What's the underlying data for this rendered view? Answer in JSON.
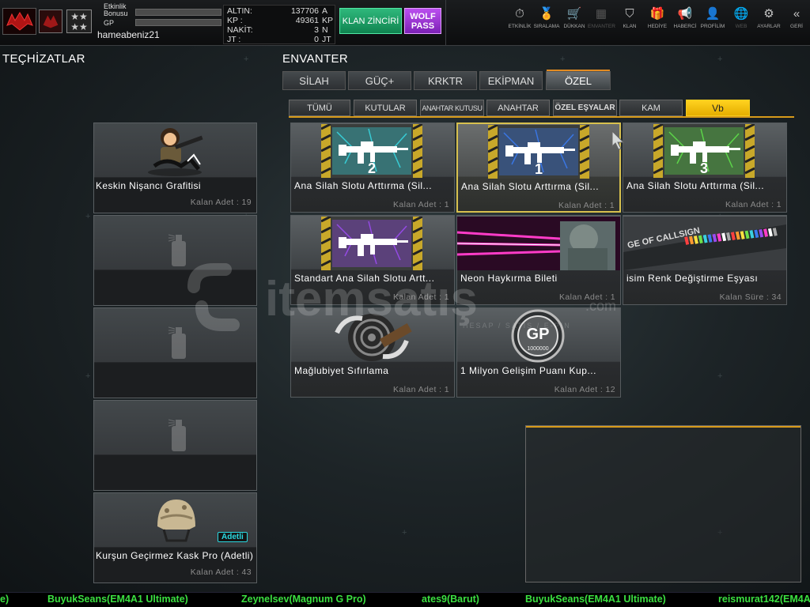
{
  "player": {
    "bonus_label": "Etkinlik\nBonusu",
    "gp_label": "GP",
    "username": "hameabeniz21",
    "rank_stars": "★★\n★★"
  },
  "currencies": [
    {
      "label": "ALTIN:",
      "value": "137706",
      "unit": "A"
    },
    {
      "label": "KP :",
      "value": "49361",
      "unit": "KP"
    },
    {
      "label": "NAKİT:",
      "value": "3",
      "unit": "N"
    },
    {
      "label": "JT :",
      "value": "0",
      "unit": "JT"
    }
  ],
  "buttons": {
    "klan": "KLAN ZİNCİRİ",
    "wolf": "WOLF\nPASS"
  },
  "nav": [
    {
      "label": "ETKİNLİK",
      "icon": "⏱",
      "name": "event",
      "dim": false
    },
    {
      "label": "SIRALAMA",
      "icon": "🏅",
      "name": "ranking",
      "dim": false
    },
    {
      "label": "DÜKKAN",
      "icon": "🛒",
      "name": "shop",
      "dim": false
    },
    {
      "label": "ENVANTER",
      "icon": "▦",
      "name": "inventory",
      "dim": true
    },
    {
      "label": "KLAN",
      "icon": "⛉",
      "name": "clan",
      "dim": false
    },
    {
      "label": "HEDİYE",
      "icon": "🎁",
      "name": "gift",
      "dim": false
    },
    {
      "label": "HABERCİ",
      "icon": "📢",
      "name": "messenger",
      "dim": false
    },
    {
      "label": "PROFİLİM",
      "icon": "👤",
      "name": "profile",
      "dim": false
    },
    {
      "label": "WEB",
      "icon": "🌐",
      "name": "web",
      "dim": true
    },
    {
      "label": "AYARLAR",
      "icon": "⚙",
      "name": "settings",
      "dim": false
    },
    {
      "label": "GERİ",
      "icon": "«",
      "name": "back",
      "dim": false
    }
  ],
  "left": {
    "title": "TEÇHİZATLAR",
    "slots": [
      {
        "name": "Keskin Nişancı Grafitisi",
        "count": "Kalan Adet : 19",
        "empty": false,
        "type": "graffiti"
      },
      {
        "name": "",
        "count": "",
        "empty": true,
        "type": "spray"
      },
      {
        "name": "",
        "count": "",
        "empty": true,
        "type": "spray"
      },
      {
        "name": "",
        "count": "",
        "empty": true,
        "type": "spray"
      },
      {
        "name": "Kurşun Geçirmez Kask Pro (Adetli)",
        "count": "Kalan Adet : 43",
        "empty": false,
        "type": "helmet",
        "badge": "Adetli"
      }
    ]
  },
  "inventory": {
    "title": "ENVANTER",
    "tabs": [
      "SİLAH",
      "GÜÇ+",
      "KRKTR",
      "EKİPMAN",
      "ÖZEL"
    ],
    "active_tab": 4,
    "subtabs": [
      "TÜMÜ",
      "KUTULAR",
      "ANAHTAR KUTUSU",
      "ANAHTAR",
      "ÖZEL EŞYALAR",
      "KAM",
      "Vb"
    ],
    "active_subtab": 6,
    "items": [
      {
        "name": "Ana Silah Slotu Arttırma (Sil...",
        "count": "Kalan Adet : 1",
        "art": "gun",
        "color": "#37d6e0",
        "num": "2",
        "selected": false
      },
      {
        "name": "Ana Silah Slotu Arttırma (Sil...",
        "count": "Kalan Adet : 1",
        "art": "gun",
        "color": "#3a7bf0",
        "num": "1",
        "selected": true
      },
      {
        "name": "Ana Silah Slotu Arttırma (Sil...",
        "count": "Kalan Adet : 1",
        "art": "gun",
        "color": "#5fe04a",
        "num": "3",
        "selected": false
      },
      {
        "name": "Standart Ana Silah Slotu Artt...",
        "count": "Kalan Adet : 1",
        "art": "gun",
        "color": "#9b4bf0",
        "num": "",
        "selected": false
      },
      {
        "name": "Neon Haykırma Bileti",
        "count": "Kalan Adet : 1",
        "art": "neon",
        "color": "#ff3cc8",
        "num": "",
        "selected": false
      },
      {
        "name": "isim Renk Değiştirme Eşyası",
        "count": "Kalan Süre : 34",
        "art": "callsign",
        "color": "#aaaaaa",
        "num": "",
        "caption": "GE OF CALLSIGN",
        "selected": false
      },
      {
        "name": "Mağlubiyet  Sıfırlama",
        "count": "Kalan Adet : 1",
        "art": "target",
        "color": "#888888",
        "num": "",
        "selected": false
      },
      {
        "name": "1 Milyon Gelişim Puanı Kup...",
        "count": "Kalan Adet : 12",
        "art": "gp",
        "color": "#999999",
        "num": "",
        "caption": "GP",
        "sub": "1000000",
        "selected": false
      }
    ]
  },
  "watermark": {
    "text": "itemsatış",
    "domain": ".com",
    "tagline": "HESAP / SATIŞ / E-PIN"
  },
  "ticker": [
    "e)",
    "BuyukSeans(EM4A1 Ultimate)",
    "Zeynelsev(Magnum G Pro)",
    "ates9(Barut)",
    "BuyukSeans(EM4A1 Ultimate)",
    "reismurat142(EM4A1"
  ]
}
